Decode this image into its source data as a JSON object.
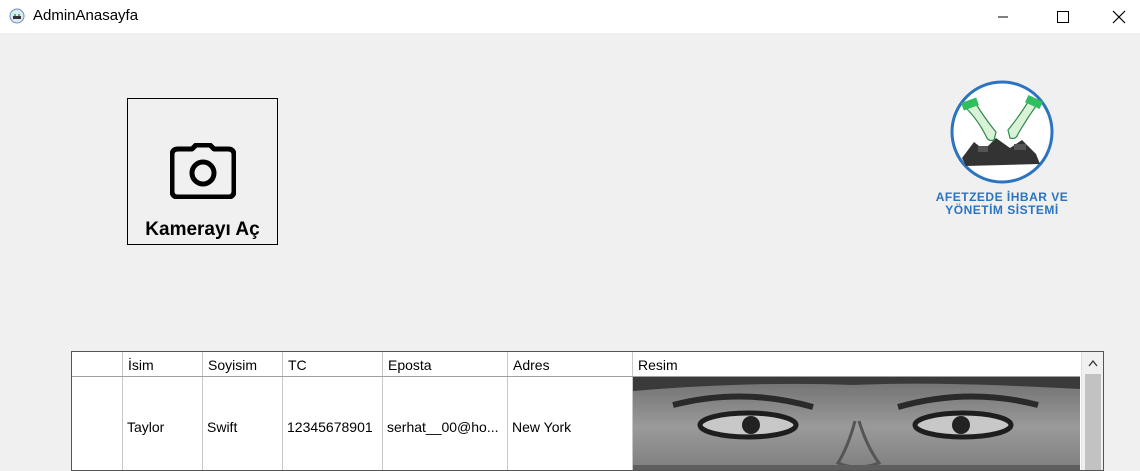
{
  "window": {
    "title": "AdminAnasayfa"
  },
  "camera": {
    "label": "Kamerayı Aç",
    "icon": "camera-icon"
  },
  "logo": {
    "line1": "AFETZEDE İHBAR VE",
    "line2": "YÖNETİM SİSTEMİ"
  },
  "grid": {
    "columns": [
      "İsim",
      "Soyisim",
      "TC",
      "Eposta",
      "Adres",
      "Resim"
    ],
    "rows": [
      {
        "isim": "Taylor",
        "soyisim": "Swift",
        "tc": "12345678901",
        "eposta": "serhat__00@ho...",
        "adres": "New York"
      }
    ]
  }
}
